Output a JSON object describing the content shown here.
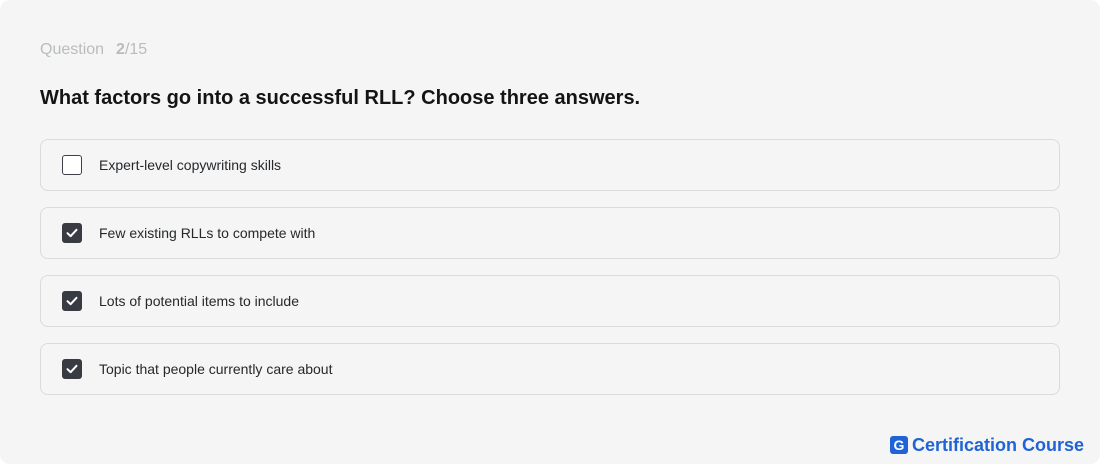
{
  "quiz": {
    "progress_label": "Question",
    "current": "2",
    "total": "/15",
    "question": "What factors go into a successful RLL? Choose three answers.",
    "options": [
      {
        "label": "Expert-level copywriting skills",
        "checked": false
      },
      {
        "label": "Few existing RLLs to compete with",
        "checked": true
      },
      {
        "label": "Lots of potential items to include",
        "checked": true
      },
      {
        "label": "Topic that people currently care about",
        "checked": true
      }
    ]
  },
  "brand": {
    "logo_letter": "G",
    "name": "Certification Course",
    "color": "#1f63d6"
  },
  "icons": {
    "checkbox_checked": "check-icon"
  }
}
